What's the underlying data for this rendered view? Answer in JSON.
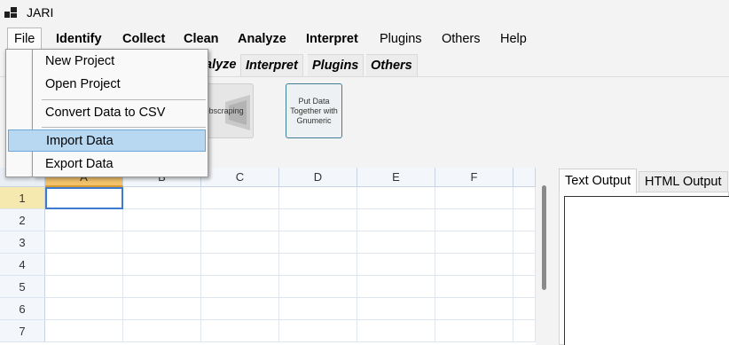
{
  "app": {
    "title": "JARI"
  },
  "menubar": {
    "items": [
      {
        "label": "File"
      },
      {
        "label": "Identify"
      },
      {
        "label": "Collect"
      },
      {
        "label": "Clean"
      },
      {
        "label": "Analyze"
      },
      {
        "label": "Interpret"
      },
      {
        "label": "Plugins"
      },
      {
        "label": "Others"
      },
      {
        "label": "Help"
      }
    ]
  },
  "ribbon": {
    "tabs": [
      {
        "label": "alyze"
      },
      {
        "label": "Interpret"
      },
      {
        "label": "Plugins"
      },
      {
        "label": "Others"
      }
    ],
    "buttons": {
      "webscraping": "Webscraping",
      "grumeric": "Put Data Together with Gnumeric"
    }
  },
  "file_menu": {
    "items": [
      {
        "label": "New Project"
      },
      {
        "label": "Open Project"
      },
      {
        "label": "Convert Data to CSV"
      },
      {
        "label": "Import Data"
      },
      {
        "label": "Export Data"
      }
    ],
    "highlighted": "Import Data"
  },
  "grid": {
    "columns": [
      "A",
      "B",
      "C",
      "D",
      "E",
      "F"
    ],
    "rows": [
      "1",
      "2",
      "3",
      "4",
      "5",
      "6",
      "7"
    ],
    "selected_cell": "A1"
  },
  "output": {
    "tabs": [
      {
        "label": "Text Output"
      },
      {
        "label": "HTML Output"
      }
    ],
    "active_tab": "Text Output"
  },
  "colors": {
    "highlight": "#b8d7f0",
    "selected_column": "#f2c36b",
    "selection_border": "#3d7bd1"
  }
}
